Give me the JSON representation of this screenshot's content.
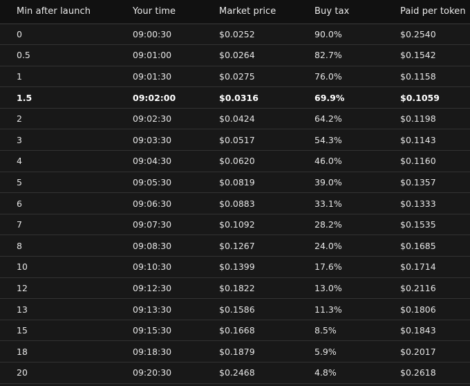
{
  "table": {
    "columns": [
      "Min after launch",
      "Your time",
      "Market price",
      "Buy tax",
      "Paid per token"
    ],
    "rows": [
      {
        "min": "0",
        "time": "09:00:30",
        "price": "$0.0252",
        "tax": "90.0%",
        "paid": "$0.2540",
        "bold": false
      },
      {
        "min": "0.5",
        "time": "09:01:00",
        "price": "$0.0264",
        "tax": "82.7%",
        "paid": "$0.1542",
        "bold": false
      },
      {
        "min": "1",
        "time": "09:01:30",
        "price": "$0.0275",
        "tax": "76.0%",
        "paid": "$0.1158",
        "bold": false
      },
      {
        "min": "1.5",
        "time": "09:02:00",
        "price": "$0.0316",
        "tax": "69.9%",
        "paid": "$0.1059",
        "bold": true
      },
      {
        "min": "2",
        "time": "09:02:30",
        "price": "$0.0424",
        "tax": "64.2%",
        "paid": "$0.1198",
        "bold": false
      },
      {
        "min": "3",
        "time": "09:03:30",
        "price": "$0.0517",
        "tax": "54.3%",
        "paid": "$0.1143",
        "bold": false
      },
      {
        "min": "4",
        "time": "09:04:30",
        "price": "$0.0620",
        "tax": "46.0%",
        "paid": "$0.1160",
        "bold": false
      },
      {
        "min": "5",
        "time": "09:05:30",
        "price": "$0.0819",
        "tax": "39.0%",
        "paid": "$0.1357",
        "bold": false
      },
      {
        "min": "6",
        "time": "09:06:30",
        "price": "$0.0883",
        "tax": "33.1%",
        "paid": "$0.1333",
        "bold": false
      },
      {
        "min": "7",
        "time": "09:07:30",
        "price": "$0.1092",
        "tax": "28.2%",
        "paid": "$0.1535",
        "bold": false
      },
      {
        "min": "8",
        "time": "09:08:30",
        "price": "$0.1267",
        "tax": "24.0%",
        "paid": "$0.1685",
        "bold": false
      },
      {
        "min": "10",
        "time": "09:10:30",
        "price": "$0.1399",
        "tax": "17.6%",
        "paid": "$0.1714",
        "bold": false
      },
      {
        "min": "12",
        "time": "09:12:30",
        "price": "$0.1822",
        "tax": "13.0%",
        "paid": "$0.2116",
        "bold": false
      },
      {
        "min": "13",
        "time": "09:13:30",
        "price": "$0.1586",
        "tax": "11.3%",
        "paid": "$0.1806",
        "bold": false
      },
      {
        "min": "15",
        "time": "09:15:30",
        "price": "$0.1668",
        "tax": "8.5%",
        "paid": "$0.1843",
        "bold": false
      },
      {
        "min": "18",
        "time": "09:18:30",
        "price": "$0.1879",
        "tax": "5.9%",
        "paid": "$0.2017",
        "bold": false
      },
      {
        "min": "20",
        "time": "09:20:30",
        "price": "$0.2468",
        "tax": "4.8%",
        "paid": "$0.2618",
        "bold": false
      }
    ]
  }
}
